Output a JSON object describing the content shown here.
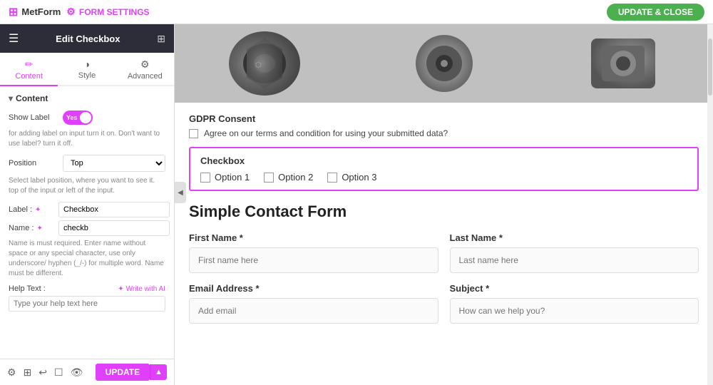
{
  "topbar": {
    "logo": "MetForm",
    "form_settings_label": "FORM SETTINGS",
    "update_close_label": "UPDATE & CLOSE"
  },
  "sidebar": {
    "header_title": "Edit Checkbox",
    "tabs": [
      {
        "label": "Content",
        "icon": "✏️"
      },
      {
        "label": "Style",
        "icon": "◑"
      },
      {
        "label": "Advanced",
        "icon": "⚙️"
      }
    ],
    "content_section": "Content",
    "show_label": "Show Label",
    "toggle_value": "Yes",
    "show_label_hint": "for adding label on input turn it on. Don't want to use label? turn it off.",
    "position_label": "Position",
    "position_value": "Top",
    "position_hint": "Select label position, where you want to see it. top of the input or left of the input.",
    "label_field_label": "Label :",
    "label_value": "Checkbox",
    "name_field_label": "Name :",
    "name_value": "checkb",
    "name_hint": "Name is must required. Enter name without space or any special character, use only underscore/ hyphen (_/-) for multiple word. Name must be different.",
    "help_text_label": "Help Text :",
    "write_ai_label": "Write with AI",
    "help_text_placeholder": "Type your help text here",
    "update_label": "UPDATE",
    "bottom_icons": [
      "⚙️",
      "⊞",
      "↩",
      "☐",
      "👁"
    ]
  },
  "preview": {
    "gdpr_title": "GDPR Consent",
    "gdpr_text": "Agree on our terms and condition for using your submitted data?",
    "checkbox_widget_title": "Checkbox",
    "checkbox_options": [
      "Option 1",
      "Option 2",
      "Option 3"
    ],
    "form_title": "Simple Contact Form",
    "first_name_label": "First Name *",
    "first_name_placeholder": "First name here",
    "last_name_label": "Last Name *",
    "last_name_placeholder": "Last name here",
    "email_label": "Email Address *",
    "email_placeholder": "Add email",
    "subject_label": "Subject *",
    "subject_placeholder": "How can we help you?"
  }
}
